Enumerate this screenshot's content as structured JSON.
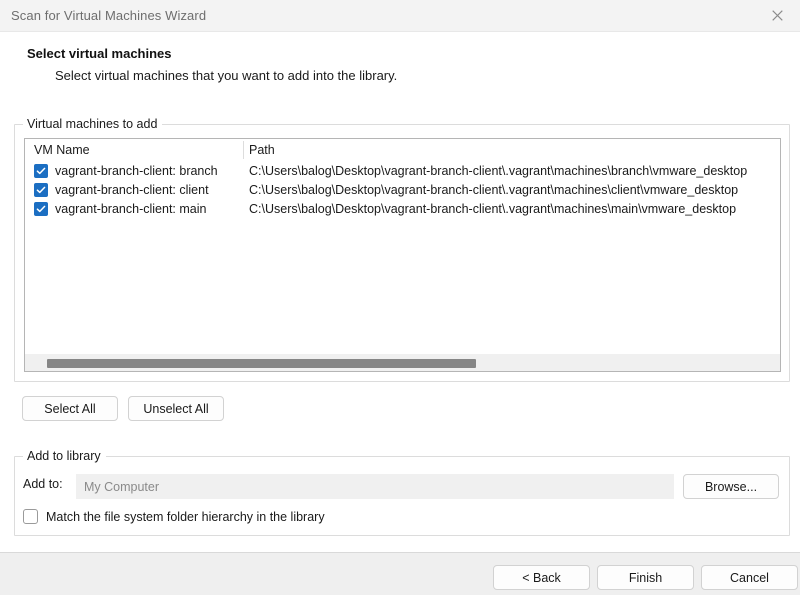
{
  "window": {
    "title": "Scan for Virtual Machines Wizard",
    "close_icon": "close-icon"
  },
  "header": {
    "title": "Select virtual machines",
    "subtitle": "Select virtual machines that you want to add into the library."
  },
  "vm_group": {
    "legend": "Virtual machines to add",
    "columns": [
      "VM Name",
      "Path"
    ],
    "rows": [
      {
        "checked": true,
        "name": "vagrant-branch-client: branch",
        "path": "C:\\Users\\balog\\Desktop\\vagrant-branch-client\\.vagrant\\machines\\branch\\vmware_desktop"
      },
      {
        "checked": true,
        "name": "vagrant-branch-client: client",
        "path": "C:\\Users\\balog\\Desktop\\vagrant-branch-client\\.vagrant\\machines\\client\\vmware_desktop"
      },
      {
        "checked": true,
        "name": "vagrant-branch-client: main",
        "path": "C:\\Users\\balog\\Desktop\\vagrant-branch-client\\.vagrant\\machines\\main\\vmware_desktop"
      }
    ],
    "select_all_label": "Select All",
    "unselect_all_label": "Unselect All"
  },
  "library_group": {
    "legend": "Add to library",
    "add_to_label": "Add to:",
    "add_to_value": "My Computer",
    "browse_label": "Browse...",
    "match_checkbox_label": "Match the file system folder hierarchy in the library",
    "match_checkbox_checked": false
  },
  "footer": {
    "back_label": "< Back",
    "finish_label": "Finish",
    "cancel_label": "Cancel"
  },
  "colors": {
    "checkbox_blue": "#1b6ec2",
    "titlebar_bg": "#f3f3f3",
    "footer_bg": "#efefef",
    "scrollbar_thumb": "#868686"
  }
}
